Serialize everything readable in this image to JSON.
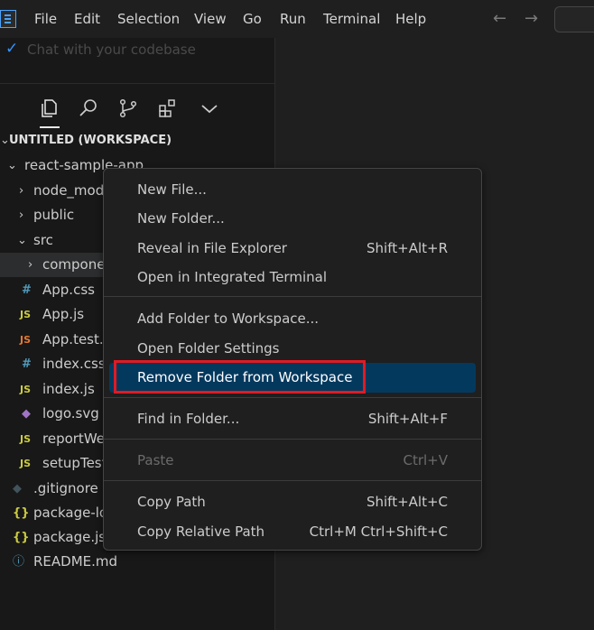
{
  "menubar": {
    "items": [
      "File",
      "Edit",
      "Selection",
      "View",
      "Go",
      "Run",
      "Terminal",
      "Help"
    ],
    "back_arrow": "←",
    "forward_arrow": "→"
  },
  "chat": {
    "text": "Chat with your codebase"
  },
  "explorer": {
    "workspace_title": "UNTITLED (WORKSPACE)",
    "tree": [
      {
        "label": "react-sample-app",
        "twisty": "⌄"
      },
      {
        "label": "node_mod",
        "twisty": "›"
      },
      {
        "label": "public",
        "twisty": "›"
      },
      {
        "label": "src",
        "twisty": "⌄"
      },
      {
        "label": "compone",
        "twisty": "›"
      },
      {
        "label": "App.css",
        "icon": "#"
      },
      {
        "label": "App.js",
        "icon": "JS"
      },
      {
        "label": "App.test.j",
        "icon": "JS"
      },
      {
        "label": "index.css",
        "icon": "#"
      },
      {
        "label": "index.js",
        "icon": "JS"
      },
      {
        "label": "logo.svg",
        "icon": "◆"
      },
      {
        "label": "reportWe",
        "icon": "JS"
      },
      {
        "label": "setupTest",
        "icon": "JS"
      },
      {
        "label": ".gitignore",
        "icon": "◆"
      },
      {
        "label": "package-lo",
        "icon": "{}"
      },
      {
        "label": "package.jso",
        "icon": "{}"
      },
      {
        "label": "README.md",
        "icon": "ⓘ"
      }
    ]
  },
  "context_menu": {
    "items": [
      {
        "label": "New File...",
        "shortcut": ""
      },
      {
        "label": "New Folder...",
        "shortcut": ""
      },
      {
        "label": "Reveal in File Explorer",
        "shortcut": "Shift+Alt+R"
      },
      {
        "label": "Open in Integrated Terminal",
        "shortcut": ""
      },
      {
        "label": "Add Folder to Workspace...",
        "shortcut": ""
      },
      {
        "label": "Open Folder Settings",
        "shortcut": ""
      },
      {
        "label": "Remove Folder from Workspace",
        "shortcut": ""
      },
      {
        "label": "Find in Folder...",
        "shortcut": "Shift+Alt+F"
      },
      {
        "label": "Paste",
        "shortcut": "Ctrl+V"
      },
      {
        "label": "Copy Path",
        "shortcut": "Shift+Alt+C"
      },
      {
        "label": "Copy Relative Path",
        "shortcut": "Ctrl+M Ctrl+Shift+C"
      }
    ]
  },
  "colors": {
    "accent": "#3794ff",
    "highlight": "#04395e",
    "annotation_box": "#e01b24",
    "js_icon": "#cbcb41",
    "css_icon": "#519aba",
    "svg_icon": "#a074c4",
    "git_icon": "#41535b",
    "json_icon": "#cbcb41",
    "readme_icon": "#519aba",
    "test_icon": "#e37933"
  }
}
